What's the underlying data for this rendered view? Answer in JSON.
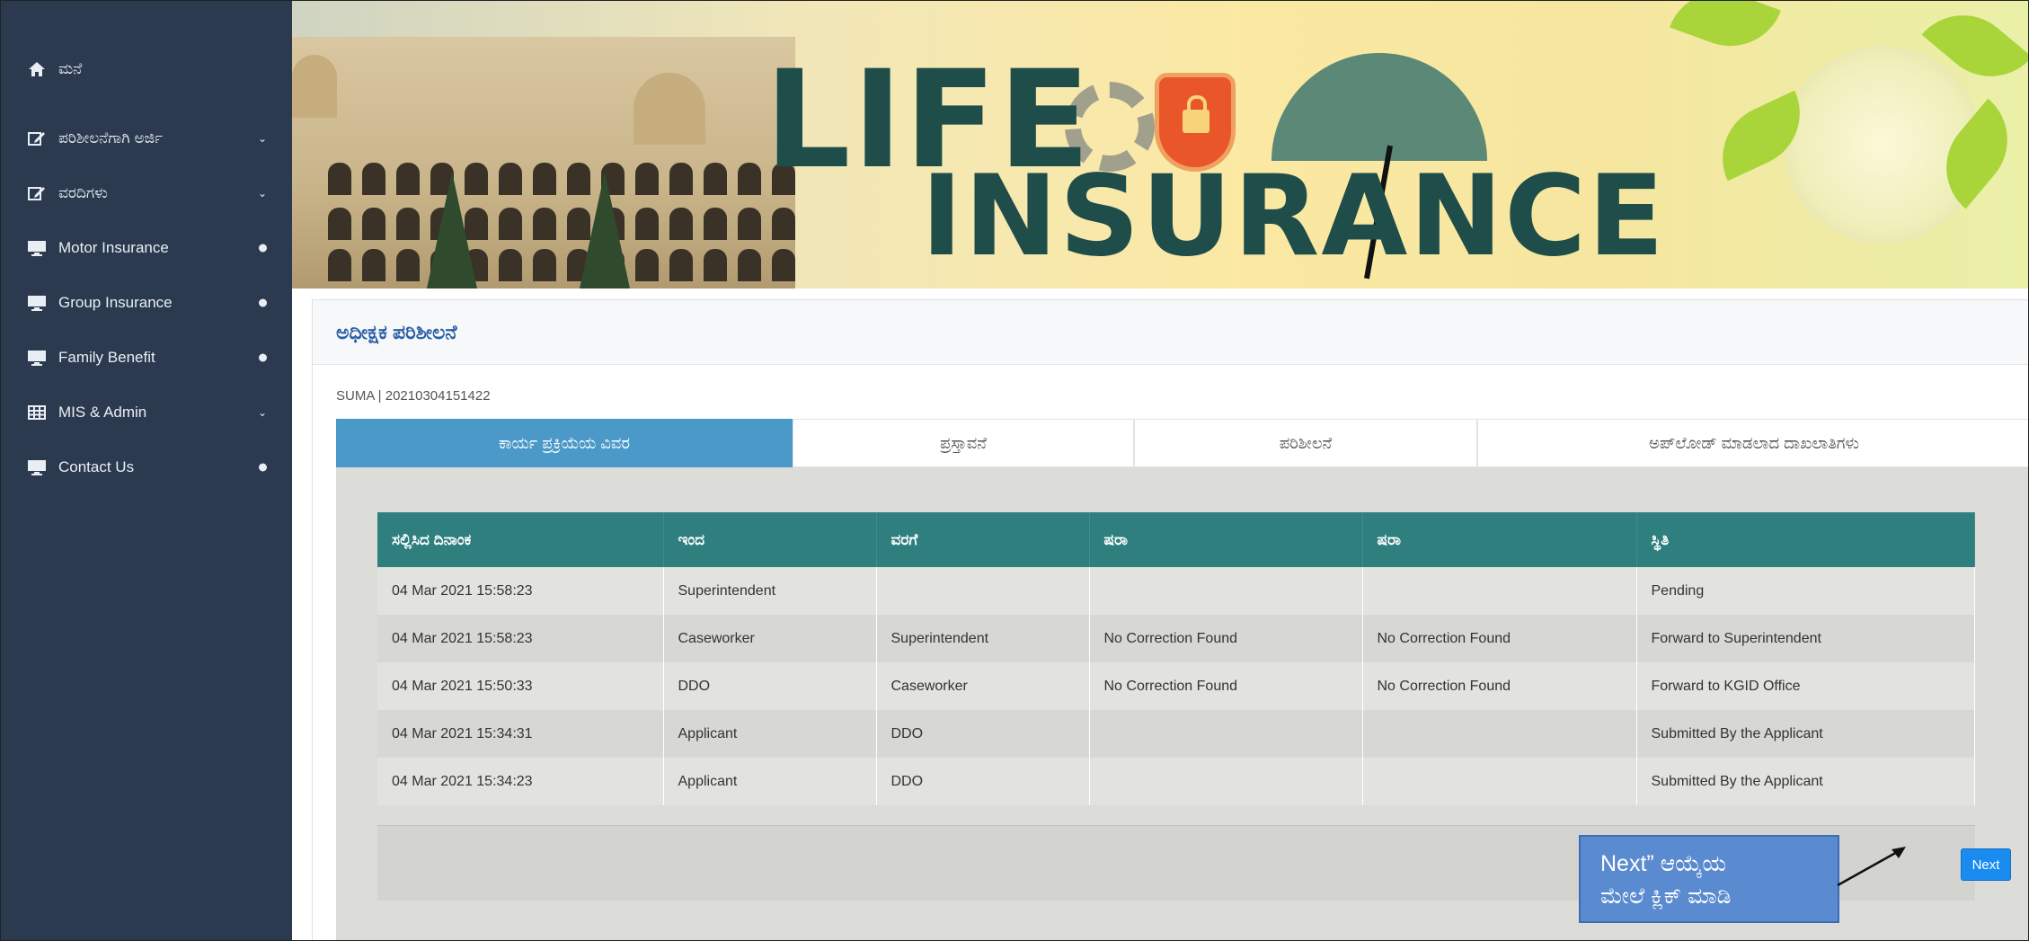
{
  "sidebar": {
    "items": [
      {
        "label": "ಮನೆ",
        "icon": "home-icon",
        "right": ""
      },
      {
        "label": "ಪರಿಶೀಲನೆಗಾಗಿ ಅರ್ಜಿ",
        "icon": "edit-icon",
        "right": "⌄"
      },
      {
        "label": "ವರದಿಗಳು",
        "icon": "edit-icon",
        "right": "⌄"
      },
      {
        "label": "Motor Insurance",
        "icon": "monitor-icon",
        "right": "dot"
      },
      {
        "label": "Group Insurance",
        "icon": "monitor-icon",
        "right": "dot"
      },
      {
        "label": "Family Benefit",
        "icon": "monitor-icon",
        "right": "dot"
      },
      {
        "label": "MIS & Admin",
        "icon": "table-icon",
        "right": "⌄"
      },
      {
        "label": "Contact Us",
        "icon": "monitor-icon",
        "right": "dot"
      }
    ]
  },
  "banner": {
    "title_line1": "LIFE",
    "title_line2": "INSURANCE"
  },
  "card": {
    "title": "ಅಧೀಕ್ಷಕ ಪರಿಶೀಲನೆ",
    "subline": "SUMA | 20210304151422"
  },
  "tabs": [
    {
      "label": "ಕಾರ್ಯ ಪ್ರಕ್ರಿಯೆಯ ವಿವರ",
      "active": true
    },
    {
      "label": "ಪ್ರಸ್ತಾವನೆ",
      "active": false
    },
    {
      "label": "ಪರಿಶೀಲನೆ",
      "active": false
    },
    {
      "label": "ಅಪ್‌ಲೋಡ್ ಮಾಡಲಾದ ದಾಖಲಾತಿಗಳು",
      "active": false
    }
  ],
  "table": {
    "headers": [
      "ಸಲ್ಲಿಸಿದ ದಿನಾಂಕ",
      "ಇಂದ",
      "ವರಗೆ",
      "ಷರಾ",
      "ಷರಾ",
      "ಸ್ಥಿತಿ"
    ],
    "rows": [
      [
        "04 Mar 2021 15:58:23",
        "Superintendent",
        "",
        "",
        "",
        "Pending"
      ],
      [
        "04 Mar 2021 15:58:23",
        "Caseworker",
        "Superintendent",
        "No Correction Found",
        "No Correction Found",
        "Forward to Superintendent"
      ],
      [
        "04 Mar 2021 15:50:33",
        "DDO",
        "Caseworker",
        "No Correction Found",
        "No Correction Found",
        "Forward to KGID Office"
      ],
      [
        "04 Mar 2021 15:34:31",
        "Applicant",
        "DDO",
        "",
        "",
        "Submitted By the Applicant"
      ],
      [
        "04 Mar 2021 15:34:23",
        "Applicant",
        "DDO",
        "",
        "",
        "Submitted By the Applicant"
      ]
    ]
  },
  "next_label": "Next",
  "callout": {
    "line1": "Next” ಆಯ್ಕೆಯ",
    "line2": "ಮೇಲೆ ಕ್ಲಿಕ್ ಮಾಡಿ"
  },
  "colors": {
    "sidebar": "#2b3a4f",
    "tab_active": "#4a99c9",
    "table_header": "#2f7f7f",
    "next_button": "#1a8cf0",
    "callout": "#5a8ad0"
  }
}
